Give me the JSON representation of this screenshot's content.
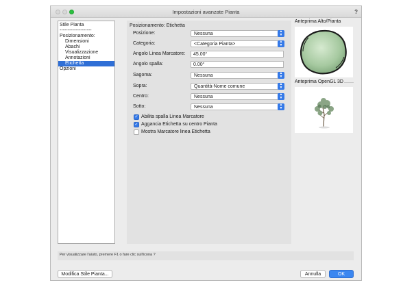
{
  "window": {
    "title": "Impostazioni avanzate Pianta",
    "help_glyph": "?"
  },
  "sidebar": {
    "items": [
      {
        "label": "Stile Pianta",
        "indent": 0,
        "selected": false
      },
      {
        "label": "--------------------",
        "indent": 0,
        "selected": false
      },
      {
        "label": "Posizionamento:",
        "indent": 0,
        "selected": false
      },
      {
        "label": "Dimensioni",
        "indent": 1,
        "selected": false
      },
      {
        "label": "Abachi",
        "indent": 1,
        "selected": false
      },
      {
        "label": "Visualizzazione",
        "indent": 1,
        "selected": false
      },
      {
        "label": "Annotazioni",
        "indent": 1,
        "selected": false
      },
      {
        "label": "Etichetta",
        "indent": 1,
        "selected": true
      },
      {
        "label": "Opzioni",
        "indent": 0,
        "selected": false
      }
    ]
  },
  "panel": {
    "title": "Posizionamento: Etichetta",
    "fields": {
      "posizione": {
        "label": "Posizione:",
        "value": "Nessuna"
      },
      "categoria": {
        "label": "Categoria:",
        "value": "<Categoria Pianta>"
      },
      "angolo_marcatore": {
        "label": "Angolo Linea Marcatore:",
        "value": "45.00°"
      },
      "angolo_spalla": {
        "label": "Angolo spalla:",
        "value": "0.00°"
      },
      "sagoma": {
        "label": "Sagoma:",
        "value": "Nessuna"
      },
      "sopra": {
        "label": "Sopra:",
        "value": "Quantità-Nome comune"
      },
      "centro": {
        "label": "Centro:",
        "value": "Nessuna"
      },
      "sotto": {
        "label": "Sotto:",
        "value": "Nessuna"
      }
    },
    "checkboxes": {
      "abilita_spalla": {
        "label": "Abilita spalla Linea Marcatore",
        "checked": true
      },
      "aggancia_etichetta": {
        "label": "Aggancia Etichetta su centro Pianta",
        "checked": true
      },
      "mostra_marcatore": {
        "label": "Mostra Marcatore linea Etichetta",
        "checked": false
      }
    }
  },
  "previews": {
    "top_title": "Anteprima Alto/Pianta",
    "opengl_title": "Anteprima OpenGL 3D"
  },
  "help_bar": {
    "text": "Per visualizzare l'aiuto, premere F1 o fare clic sull'icona ?"
  },
  "buttons": {
    "modify_style": "Modifica Stile Pianta...",
    "cancel": "Annulla",
    "ok": "OK"
  },
  "colors": {
    "accent": "#3479e8",
    "selection": "#2f6fd6"
  }
}
